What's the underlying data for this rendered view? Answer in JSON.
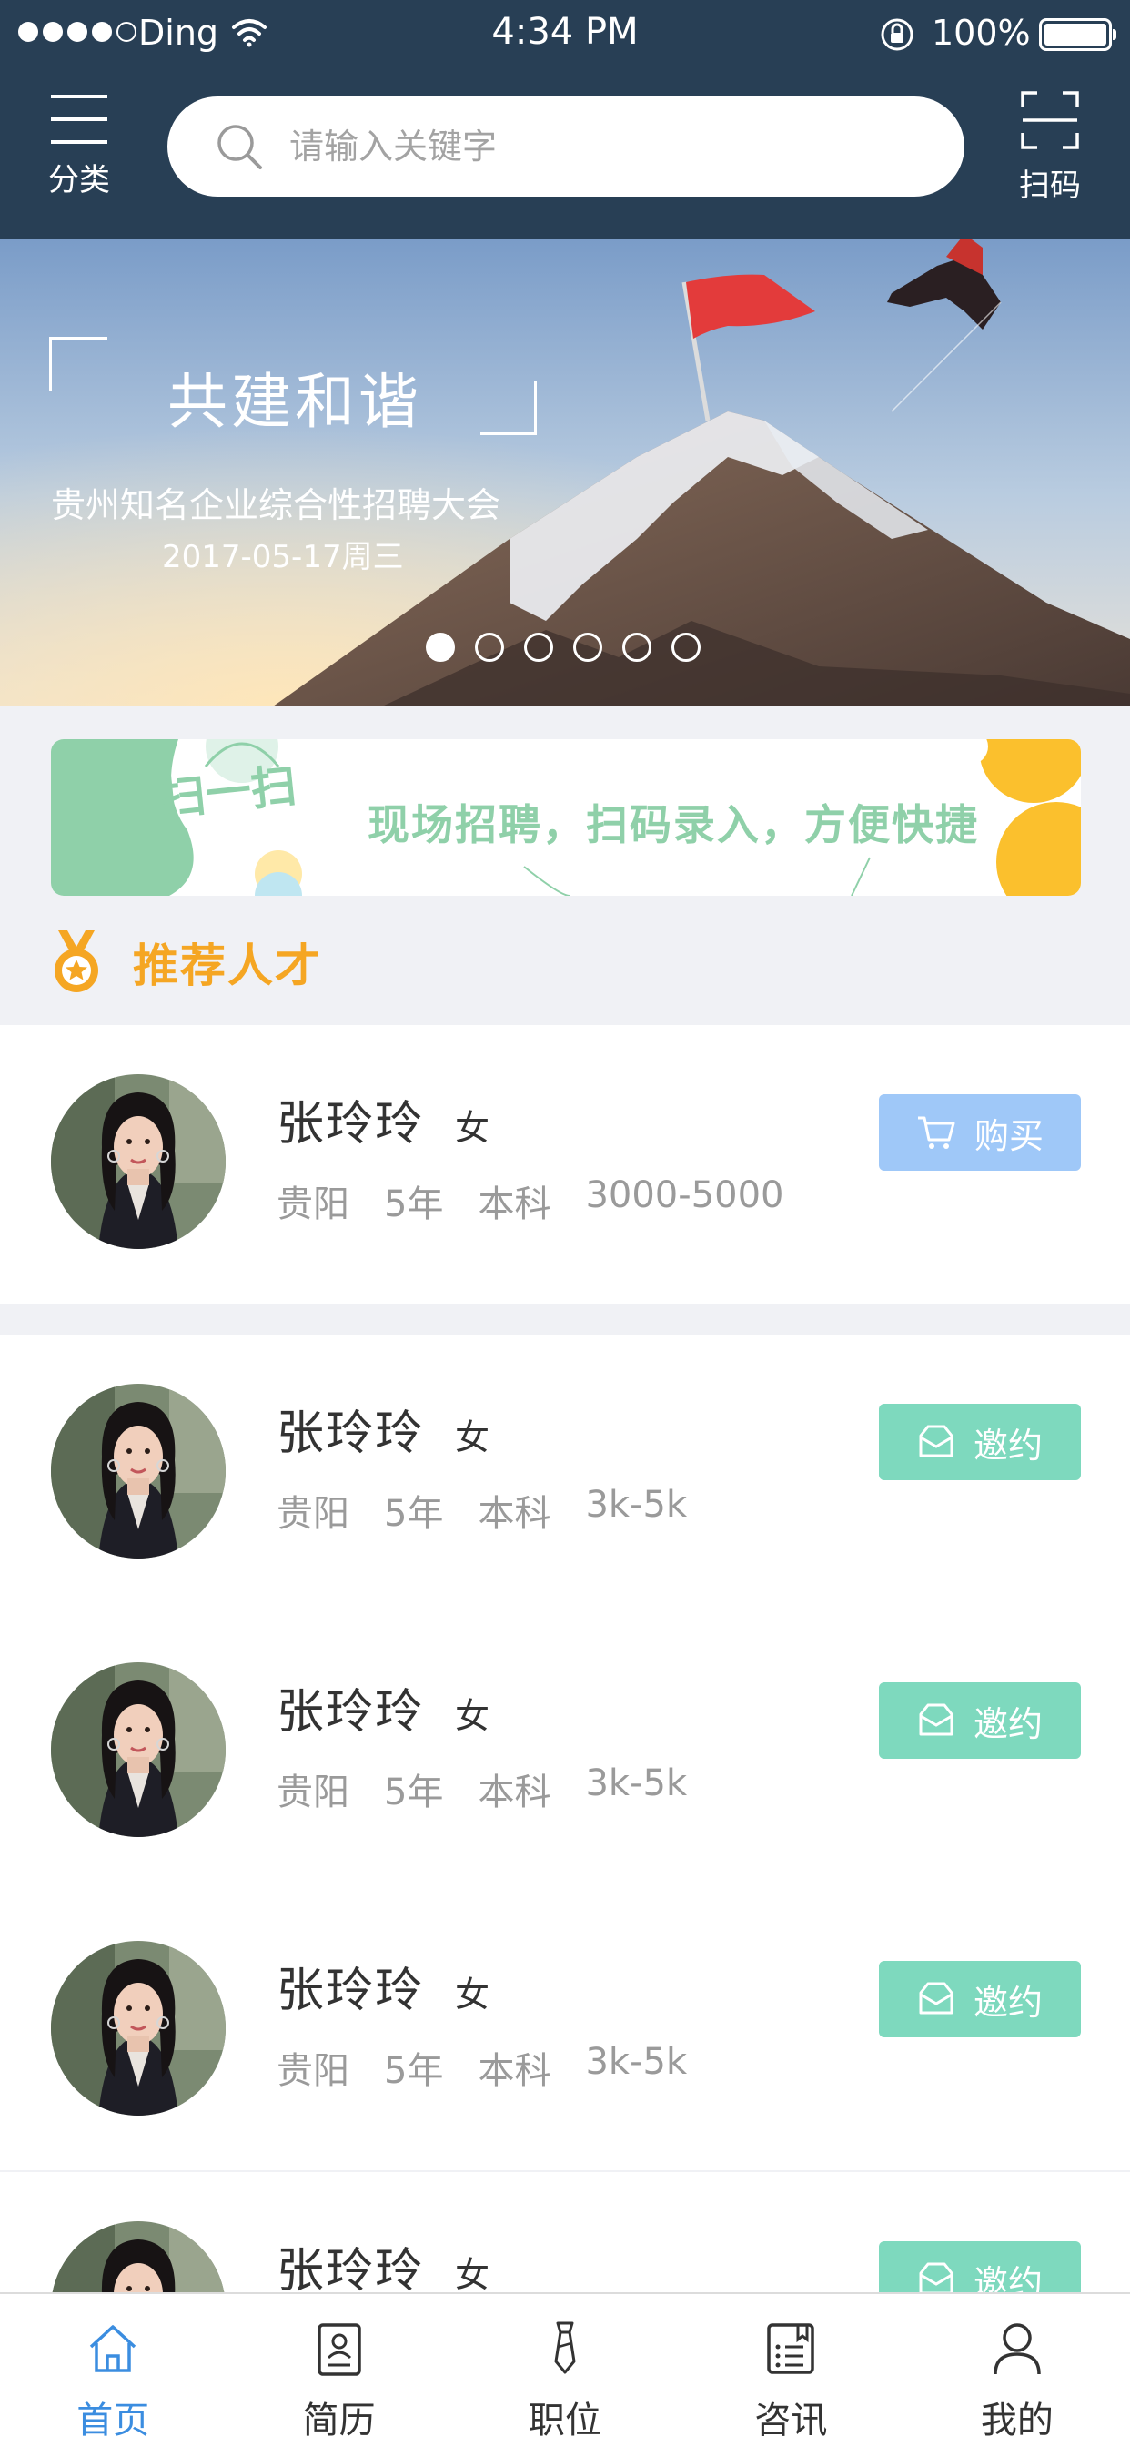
{
  "status_bar": {
    "carrier": "Ding",
    "time": "4:34 PM",
    "battery": "100%"
  },
  "header": {
    "category_label": "分类",
    "search_placeholder": "请输入关键字",
    "scan_label": "扫码"
  },
  "banner": {
    "title": "共建和谐",
    "subtitle": "贵州知名企业综合性招聘大会",
    "date": "2017-05-17周三",
    "slide_count": 6,
    "active_slide": 1
  },
  "promo": {
    "badge_text": "扫一扫",
    "text": "现场招聘，扫码录入，方便快捷"
  },
  "section": {
    "title": "推荐人才"
  },
  "talents": [
    {
      "name": "张玲玲",
      "gender": "女",
      "city": "贵阳",
      "experience": "5年",
      "education": "本科",
      "salary": "3000-5000",
      "action": "购买",
      "action_icon": "cart-icon",
      "action_type": "buy"
    },
    {
      "name": "张玲玲",
      "gender": "女",
      "city": "贵阳",
      "experience": "5年",
      "education": "本科",
      "salary": "3k-5k",
      "action": "邀约",
      "action_icon": "envelope-icon",
      "action_type": "invite"
    },
    {
      "name": "张玲玲",
      "gender": "女",
      "city": "贵阳",
      "experience": "5年",
      "education": "本科",
      "salary": "3k-5k",
      "action": "邀约",
      "action_icon": "envelope-icon",
      "action_type": "invite"
    },
    {
      "name": "张玲玲",
      "gender": "女",
      "city": "贵阳",
      "experience": "5年",
      "education": "本科",
      "salary": "3k-5k",
      "action": "邀约",
      "action_icon": "envelope-icon",
      "action_type": "invite"
    },
    {
      "name": "张玲玲",
      "gender": "女",
      "action": "邀约",
      "action_icon": "envelope-icon",
      "action_type": "invite"
    }
  ],
  "tabbar": {
    "items": [
      {
        "label": "首页",
        "icon": "home-icon",
        "active": true
      },
      {
        "label": "简历",
        "icon": "resume-icon",
        "active": false
      },
      {
        "label": "职位",
        "icon": "tie-icon",
        "active": false
      },
      {
        "label": "咨讯",
        "icon": "news-icon",
        "active": false
      },
      {
        "label": "我的",
        "icon": "user-icon",
        "active": false
      }
    ]
  },
  "colors": {
    "header_bg": "#283f55",
    "page_bg": "#f0f1f5",
    "accent_orange": "#f5a623",
    "buy_button": "#9fc8f8",
    "invite_button": "#7ed9be",
    "tab_active": "#3b8de0",
    "promo_text": "#8fd0a9"
  }
}
